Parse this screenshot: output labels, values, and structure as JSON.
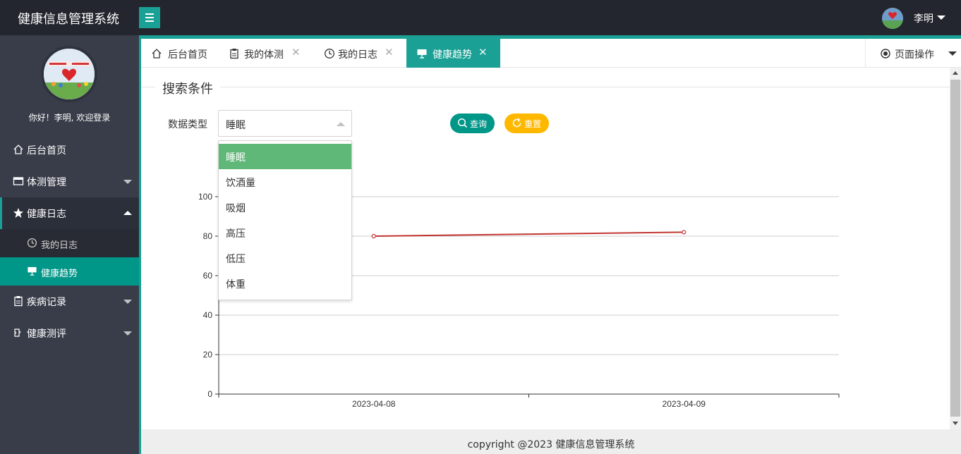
{
  "app": {
    "title": "健康信息管理系统"
  },
  "header": {
    "user_name": "李明"
  },
  "sidebar": {
    "welcome": "你好！李明, 欢迎登录",
    "items": {
      "home": "后台首页",
      "body_test": "体测管理",
      "health_log": "健康日志",
      "my_log": "我的日志",
      "health_trend": "健康趋势",
      "disease": "疾病记录",
      "evaluation": "健康测评"
    }
  },
  "tabs": {
    "home": "后台首页",
    "my_test": "我的体测",
    "my_log": "我的日志",
    "trend": "健康趋势",
    "close_glyph": "✕",
    "page_ops": "页面操作"
  },
  "search": {
    "legend": "搜索条件",
    "data_type_label": "数据类型",
    "selected": "睡眠",
    "options": [
      "睡眠",
      "饮酒量",
      "吸烟",
      "高压",
      "低压",
      "体重"
    ],
    "query_button": "查询",
    "reset_button": "重置"
  },
  "chart_data": {
    "type": "line",
    "x": [
      "2023-04-08",
      "2023-04-09"
    ],
    "series": [
      {
        "values": [
          80,
          82
        ],
        "color": "#c23531"
      }
    ],
    "ylim": [
      0,
      100
    ],
    "yticks": [
      0,
      20,
      40,
      60,
      80,
      100
    ],
    "grid": true
  },
  "footer": {
    "text": "copyright @2023 健康信息管理系统"
  },
  "colors": {
    "header_bg": "#23262e",
    "sidebar_bg": "#393d49",
    "accent": "#1aa094",
    "primary_btn": "#009688",
    "warm_btn": "#ffb800",
    "selected_option": "#5fb878"
  }
}
